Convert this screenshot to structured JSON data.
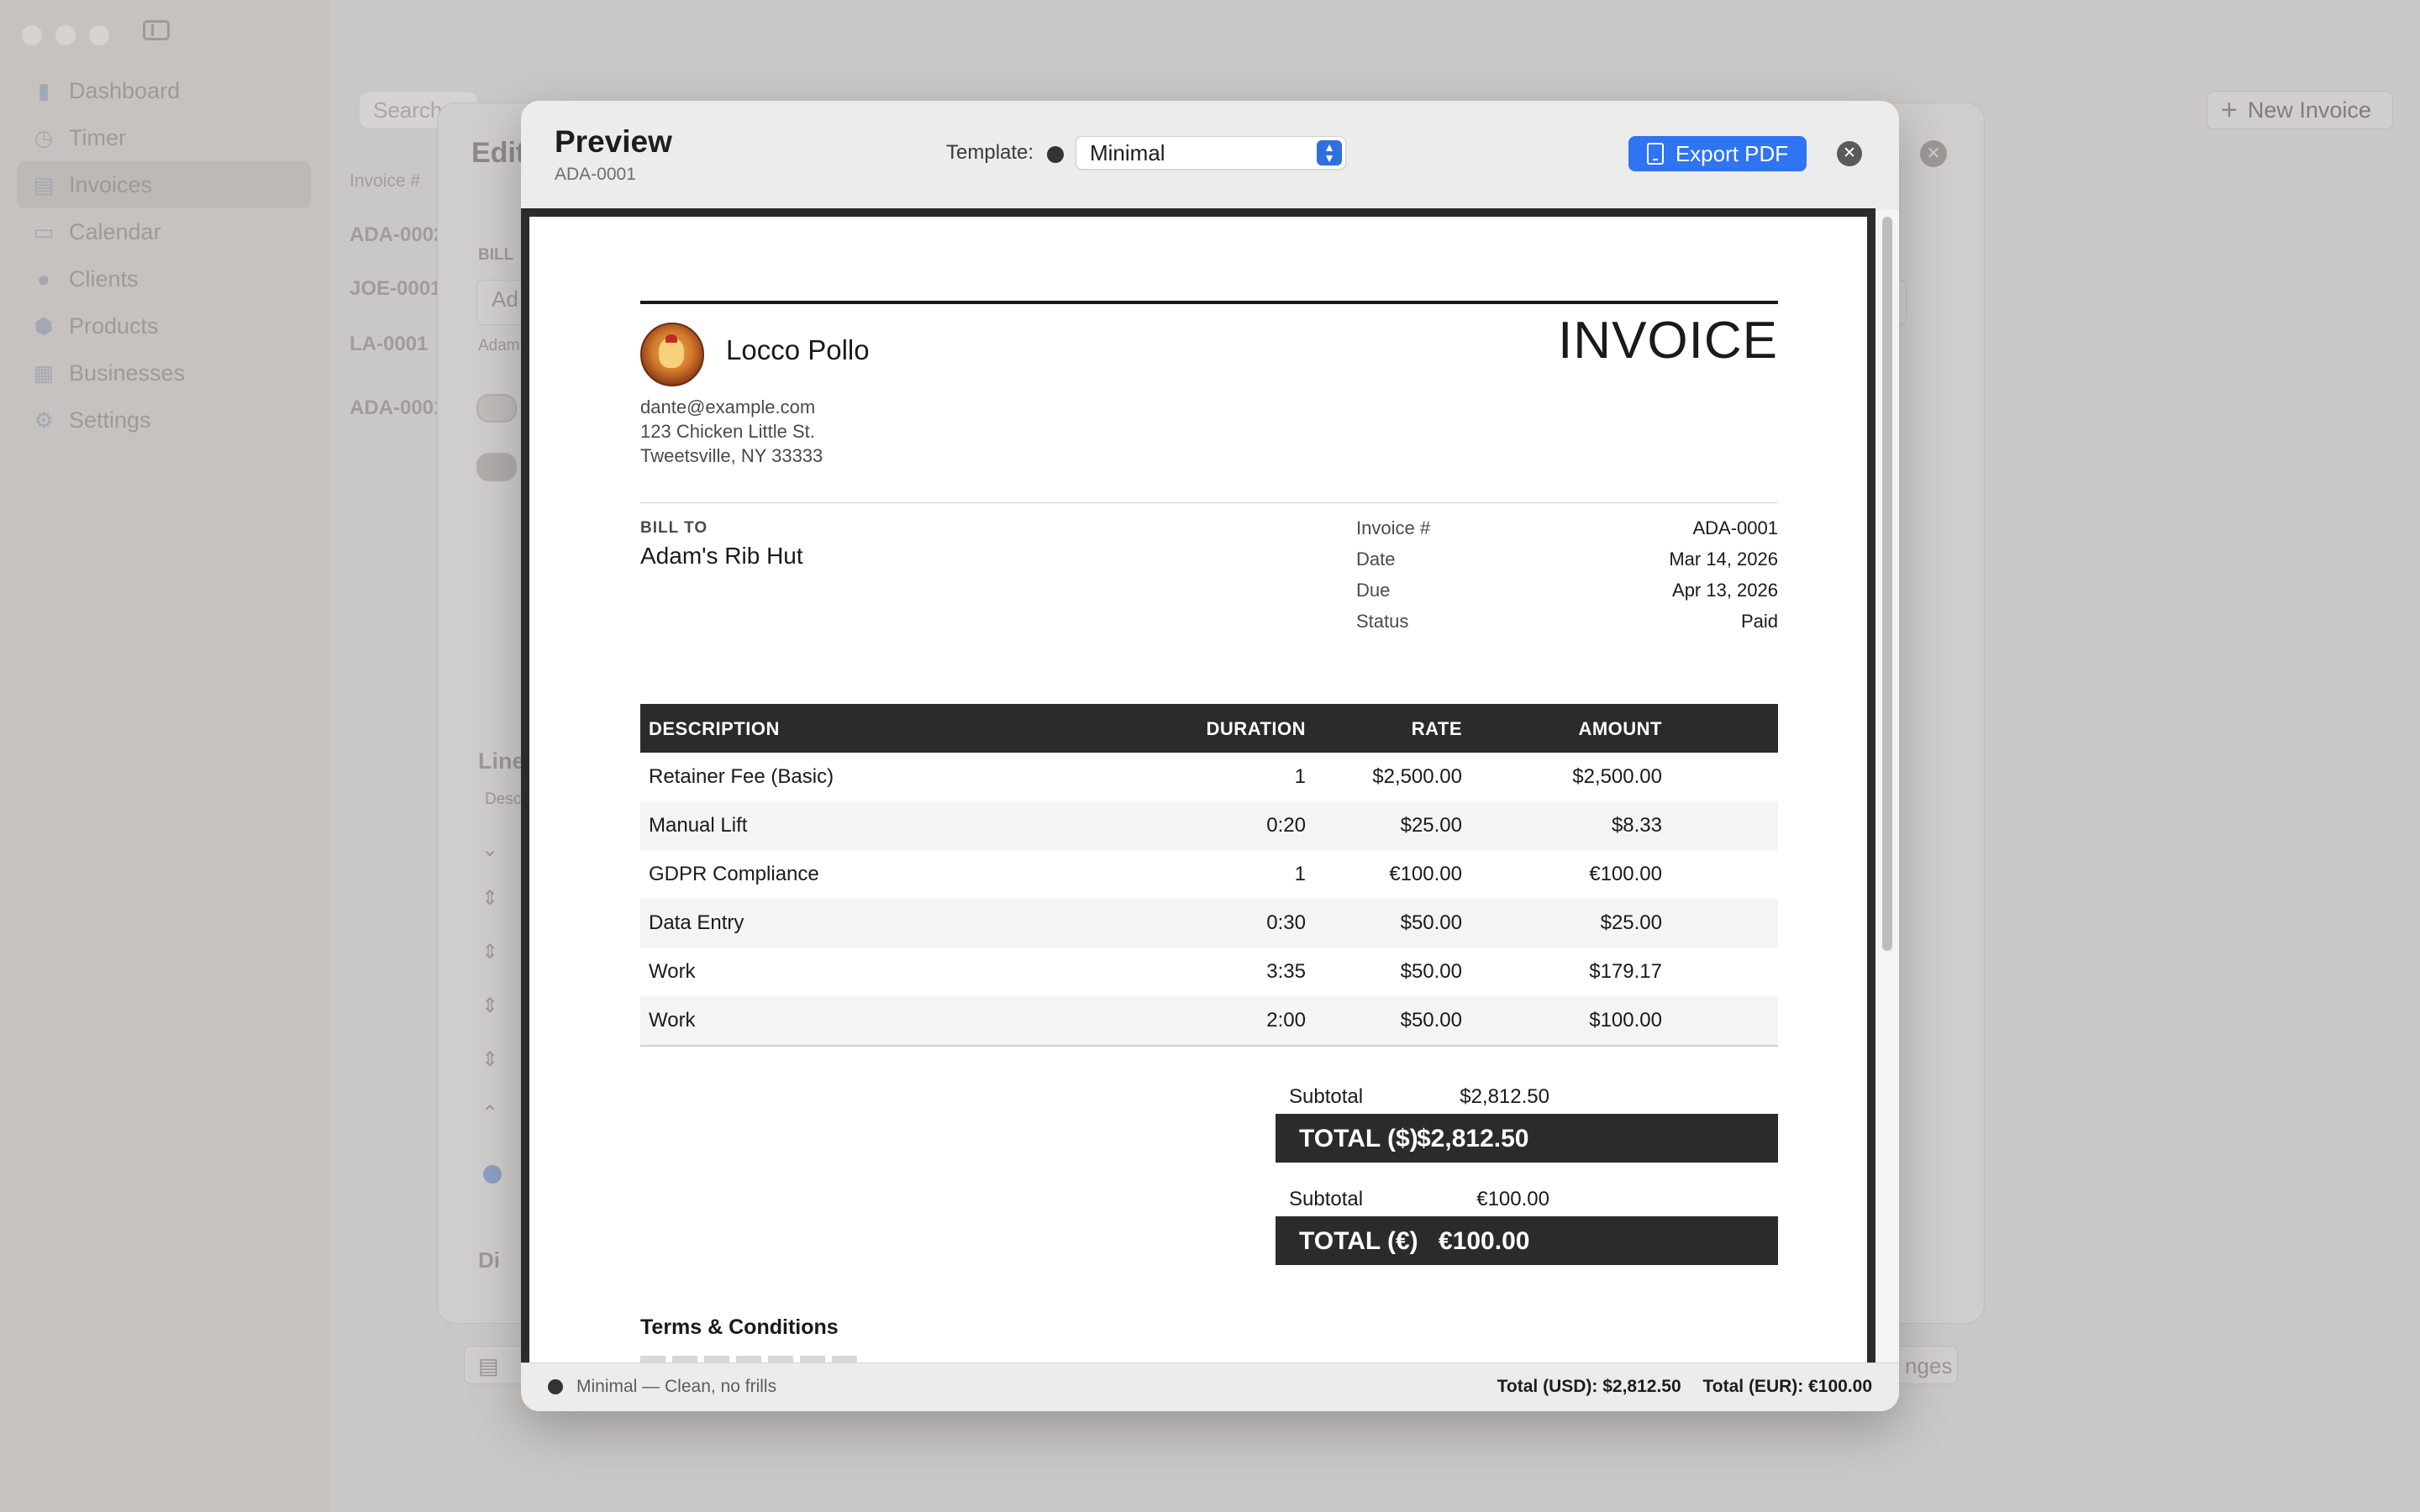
{
  "sidebar": {
    "items": [
      {
        "label": "Dashboard",
        "icon": "chart-bar-icon"
      },
      {
        "label": "Timer",
        "icon": "clock-icon"
      },
      {
        "label": "Invoices",
        "icon": "document-icon"
      },
      {
        "label": "Calendar",
        "icon": "calendar-icon"
      },
      {
        "label": "Clients",
        "icon": "people-icon"
      },
      {
        "label": "Products",
        "icon": "cube-icon"
      },
      {
        "label": "Businesses",
        "icon": "building-icon"
      },
      {
        "label": "Settings",
        "icon": "gear-icon"
      }
    ]
  },
  "background": {
    "search_placeholder": "Search",
    "new_invoice_label": "New Invoice",
    "list_header": "Invoice #",
    "list_rows": [
      "ADA-0002",
      "JOE-0001",
      "LA-0001",
      "ADA-0001"
    ],
    "edit_title": "Edit",
    "bill_label": "BILL",
    "client_field": "Ad",
    "client_sub": "Adam",
    "line_items_label": "Line",
    "desc_label": "Desc",
    "discount_label": "Di",
    "changes_label": "nges"
  },
  "modal": {
    "title": "Preview",
    "subtitle": "ADA-0001",
    "template_label": "Template:",
    "template_value": "Minimal",
    "export_label": "Export PDF",
    "footer_left": "Minimal — Clean, no frills",
    "footer_total_usd": "Total (USD): $2,812.50",
    "footer_total_eur": "Total (EUR): €100.00"
  },
  "invoice": {
    "heading": "INVOICE",
    "business_name": "Locco Pollo",
    "email": "dante@example.com",
    "address1": "123 Chicken Little St.",
    "address2": "Tweetsville, NY 33333",
    "bill_to_label": "BILL TO",
    "bill_to_name": "Adam's Rib Hut",
    "meta": [
      {
        "k": "Invoice #",
        "v": "ADA-0001"
      },
      {
        "k": "Date",
        "v": "Mar 14, 2026"
      },
      {
        "k": "Due",
        "v": "Apr 13, 2026"
      },
      {
        "k": "Status",
        "v": "Paid"
      }
    ],
    "columns": {
      "description": "DESCRIPTION",
      "duration": "DURATION",
      "rate": "RATE",
      "amount": "AMOUNT"
    },
    "rows": [
      {
        "description": "Retainer Fee (Basic)",
        "duration": "1",
        "rate": "$2,500.00",
        "amount": "$2,500.00"
      },
      {
        "description": "Manual Lift",
        "duration": "0:20",
        "rate": "$25.00",
        "amount": "$8.33"
      },
      {
        "description": "GDPR Compliance",
        "duration": "1",
        "rate": "€100.00",
        "amount": "€100.00"
      },
      {
        "description": "Data Entry",
        "duration": "0:30",
        "rate": "$50.00",
        "amount": "$25.00"
      },
      {
        "description": "Work",
        "duration": "3:35",
        "rate": "$50.00",
        "amount": "$179.17"
      },
      {
        "description": "Work",
        "duration": "2:00",
        "rate": "$50.00",
        "amount": "$100.00"
      }
    ],
    "totals": [
      {
        "subtotal_label": "Subtotal",
        "subtotal_value": "$2,812.50",
        "total_label": "TOTAL ($)",
        "total_value": "$2,812.50"
      },
      {
        "subtotal_label": "Subtotal",
        "subtotal_value": "€100.00",
        "total_label": "TOTAL (€)",
        "total_value": "€100.00"
      }
    ],
    "terms_heading": "Terms & Conditions"
  },
  "colors": {
    "accent": "#2f74f2",
    "dark": "#2b2b2b",
    "row_alt": "#f4f4f4"
  }
}
